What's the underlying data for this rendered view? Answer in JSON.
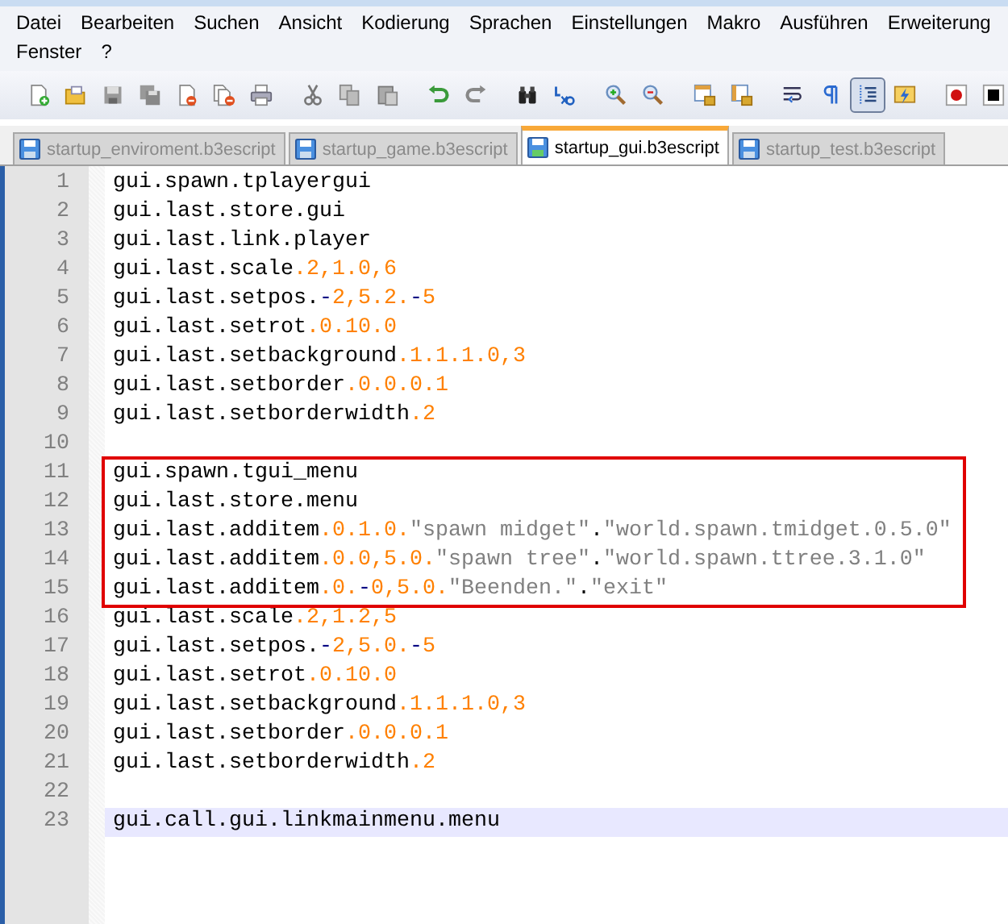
{
  "menu": [
    {
      "label": "Datei"
    },
    {
      "label": "Bearbeiten"
    },
    {
      "label": "Suchen"
    },
    {
      "label": "Ansicht"
    },
    {
      "label": "Kodierung"
    },
    {
      "label": "Sprachen"
    },
    {
      "label": "Einstellungen"
    },
    {
      "label": "Makro"
    },
    {
      "label": "Ausführen"
    },
    {
      "label": "Erweiterung"
    },
    {
      "label": "Fenster"
    },
    {
      "label": "?"
    }
  ],
  "toolbar": [
    {
      "kind": "new",
      "pressed": false
    },
    {
      "kind": "open",
      "pressed": false
    },
    {
      "kind": "save",
      "pressed": false
    },
    {
      "kind": "save-all",
      "pressed": false
    },
    {
      "kind": "close",
      "pressed": false
    },
    {
      "kind": "close-all",
      "pressed": false
    },
    {
      "kind": "print",
      "pressed": false
    },
    {
      "kind": "separator"
    },
    {
      "kind": "cut",
      "pressed": false
    },
    {
      "kind": "copy",
      "pressed": false
    },
    {
      "kind": "paste",
      "pressed": false
    },
    {
      "kind": "separator"
    },
    {
      "kind": "undo",
      "pressed": false
    },
    {
      "kind": "redo",
      "pressed": false
    },
    {
      "kind": "separator"
    },
    {
      "kind": "find",
      "pressed": false
    },
    {
      "kind": "replace",
      "pressed": false
    },
    {
      "kind": "separator"
    },
    {
      "kind": "zoom-in",
      "pressed": false
    },
    {
      "kind": "zoom-out",
      "pressed": false
    },
    {
      "kind": "separator"
    },
    {
      "kind": "sync-vertical",
      "pressed": false
    },
    {
      "kind": "sync-horizontal",
      "pressed": false
    },
    {
      "kind": "separator"
    },
    {
      "kind": "word-wrap",
      "pressed": false
    },
    {
      "kind": "show-all-characters",
      "pressed": false
    },
    {
      "kind": "indent-guide",
      "pressed": true
    },
    {
      "kind": "user-language",
      "pressed": false
    },
    {
      "kind": "separator"
    },
    {
      "kind": "record",
      "pressed": false
    },
    {
      "kind": "stop",
      "pressed": false
    }
  ],
  "tabs": [
    {
      "label": "startup_enviroment.b3escript",
      "selected": false
    },
    {
      "label": "startup_game.b3escript",
      "selected": false
    },
    {
      "label": "startup_gui.b3escript",
      "selected": true
    },
    {
      "label": "startup_test.b3escript",
      "selected": false
    }
  ],
  "editor": {
    "lines": [
      {
        "number": "1",
        "boxed": false,
        "current": false,
        "segments": [
          {
            "kind": "plain",
            "text": "gui.spawn.tplayergui"
          }
        ]
      },
      {
        "number": "2",
        "boxed": false,
        "current": false,
        "segments": [
          {
            "kind": "plain",
            "text": "gui.last.store.gui"
          }
        ]
      },
      {
        "number": "3",
        "boxed": false,
        "current": false,
        "segments": [
          {
            "kind": "plain",
            "text": "gui.last.link.player"
          }
        ]
      },
      {
        "number": "4",
        "boxed": false,
        "current": false,
        "segments": [
          {
            "kind": "plain",
            "text": "gui.last.scale"
          },
          {
            "kind": "number",
            "text": ".2,1.0,6"
          }
        ]
      },
      {
        "number": "5",
        "boxed": false,
        "current": false,
        "segments": [
          {
            "kind": "plain",
            "text": "gui.last.setpos."
          },
          {
            "kind": "operator",
            "text": "-"
          },
          {
            "kind": "number",
            "text": "2,5.2."
          },
          {
            "kind": "operator",
            "text": "-"
          },
          {
            "kind": "number",
            "text": "5"
          }
        ]
      },
      {
        "number": "6",
        "boxed": false,
        "current": false,
        "segments": [
          {
            "kind": "plain",
            "text": "gui.last.setrot"
          },
          {
            "kind": "number",
            "text": ".0.10.0"
          }
        ]
      },
      {
        "number": "7",
        "boxed": false,
        "current": false,
        "segments": [
          {
            "kind": "plain",
            "text": "gui.last.setbackground"
          },
          {
            "kind": "number",
            "text": ".1.1.1.0,3"
          }
        ]
      },
      {
        "number": "8",
        "boxed": false,
        "current": false,
        "segments": [
          {
            "kind": "plain",
            "text": "gui.last.setborder"
          },
          {
            "kind": "number",
            "text": ".0.0.0.1"
          }
        ]
      },
      {
        "number": "9",
        "boxed": false,
        "current": false,
        "segments": [
          {
            "kind": "plain",
            "text": "gui.last.setborderwidth"
          },
          {
            "kind": "number",
            "text": ".2"
          }
        ]
      },
      {
        "number": "10",
        "boxed": false,
        "current": false
      },
      {
        "number": "11",
        "boxed": true,
        "current": false,
        "segments": [
          {
            "kind": "plain",
            "text": "gui.spawn.tgui_menu"
          }
        ]
      },
      {
        "number": "12",
        "boxed": true,
        "current": false,
        "segments": [
          {
            "kind": "plain",
            "text": "gui.last.store.menu"
          }
        ]
      },
      {
        "number": "13",
        "boxed": true,
        "current": false,
        "segments": [
          {
            "kind": "plain",
            "text": "gui.last.additem"
          },
          {
            "kind": "number",
            "text": ".0.1.0."
          },
          {
            "kind": "string",
            "text": "\"spawn midget\""
          },
          {
            "kind": "plain",
            "text": "."
          },
          {
            "kind": "string",
            "text": "\"world.spawn.tmidget.0.5.0\""
          }
        ]
      },
      {
        "number": "14",
        "boxed": true,
        "current": false,
        "segments": [
          {
            "kind": "plain",
            "text": "gui.last.additem"
          },
          {
            "kind": "number",
            "text": ".0.0,5.0."
          },
          {
            "kind": "string",
            "text": "\"spawn tree\""
          },
          {
            "kind": "plain",
            "text": "."
          },
          {
            "kind": "string",
            "text": "\"world.spawn.ttree.3.1.0\""
          }
        ]
      },
      {
        "number": "15",
        "boxed": true,
        "current": false,
        "segments": [
          {
            "kind": "plain",
            "text": "gui.last.additem"
          },
          {
            "kind": "number",
            "text": ".0."
          },
          {
            "kind": "operator",
            "text": "-"
          },
          {
            "kind": "number",
            "text": "0,5.0."
          },
          {
            "kind": "string",
            "text": "\"Beenden.\""
          },
          {
            "kind": "plain",
            "text": "."
          },
          {
            "kind": "string",
            "text": "\"exit\""
          }
        ]
      },
      {
        "number": "16",
        "boxed": false,
        "current": false,
        "segments": [
          {
            "kind": "plain",
            "text": "gui.last.scale"
          },
          {
            "kind": "number",
            "text": ".2,1.2,5"
          }
        ]
      },
      {
        "number": "17",
        "boxed": false,
        "current": false,
        "segments": [
          {
            "kind": "plain",
            "text": "gui.last.setpos."
          },
          {
            "kind": "operator",
            "text": "-"
          },
          {
            "kind": "number",
            "text": "2,5.0."
          },
          {
            "kind": "operator",
            "text": "-"
          },
          {
            "kind": "number",
            "text": "5"
          }
        ]
      },
      {
        "number": "18",
        "boxed": false,
        "current": false,
        "segments": [
          {
            "kind": "plain",
            "text": "gui.last.setrot"
          },
          {
            "kind": "number",
            "text": ".0.10.0"
          }
        ]
      },
      {
        "number": "19",
        "boxed": false,
        "current": false,
        "segments": [
          {
            "kind": "plain",
            "text": "gui.last.setbackground"
          },
          {
            "kind": "number",
            "text": ".1.1.1.0,3"
          }
        ]
      },
      {
        "number": "20",
        "boxed": false,
        "current": false,
        "segments": [
          {
            "kind": "plain",
            "text": "gui.last.setborder"
          },
          {
            "kind": "number",
            "text": ".0.0.0.1"
          }
        ]
      },
      {
        "number": "21",
        "boxed": false,
        "current": false,
        "segments": [
          {
            "kind": "plain",
            "text": "gui.last.setborderwidth"
          },
          {
            "kind": "number",
            "text": ".2"
          }
        ]
      },
      {
        "number": "22",
        "boxed": false,
        "current": false
      },
      {
        "number": "23",
        "boxed": false,
        "current": true,
        "segments": [
          {
            "kind": "plain",
            "text": "gui.call.gui.linkmainmenu.menu"
          }
        ]
      }
    ]
  }
}
